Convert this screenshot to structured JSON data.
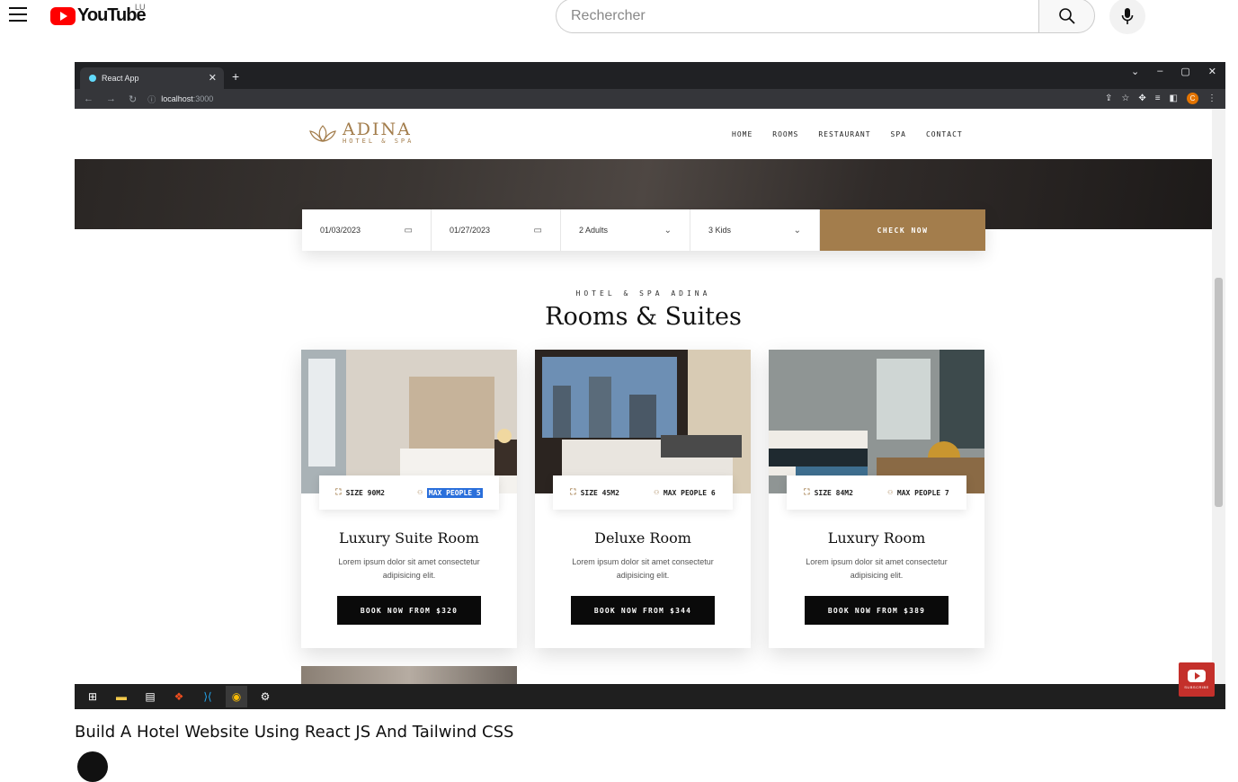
{
  "youtube": {
    "logo_text": "YouTube",
    "country": "LU",
    "search_placeholder": "Rechercher"
  },
  "browser": {
    "tab_title": "React App",
    "url_host": "localhost",
    "url_port": ":3000"
  },
  "site": {
    "brand_name": "ADINA",
    "brand_sub": "HOTEL & SPA",
    "nav": [
      "HOME",
      "ROOMS",
      "RESTAURANT",
      "SPA",
      "CONTACT"
    ],
    "booking": {
      "check_in": "01/03/2023",
      "check_out": "01/27/2023",
      "adults": "2 Adults",
      "kids": "3 Kids",
      "button": "CHECK NOW"
    },
    "rooms_eyebrow": "HOTEL & SPA ADINA",
    "rooms_title": "Rooms & Suites",
    "rooms": [
      {
        "name": "Luxury Suite Room",
        "size": "SIZE 90M2",
        "max": "MAX PEOPLE 5",
        "desc": "Lorem ipsum dolor sit amet consectetur adipisicing elit.",
        "button": "BOOK NOW FROM $320"
      },
      {
        "name": "Deluxe Room",
        "size": "SIZE 45M2",
        "max": "MAX PEOPLE 6",
        "desc": "Lorem ipsum dolor sit amet consectetur adipisicing elit.",
        "button": "BOOK NOW FROM $344"
      },
      {
        "name": "Luxury Room",
        "size": "SIZE 84M2",
        "max": "MAX PEOPLE 7",
        "desc": "Lorem ipsum dolor sit amet consectetur adipisicing elit.",
        "button": "BOOK NOW FROM $389"
      }
    ]
  },
  "video": {
    "subscribe_label": "SUBSCRIBE",
    "title": "Build A Hotel Website Using React JS And Tailwind CSS"
  },
  "colors": {
    "accent_gold": "#a37d4c",
    "youtube_red": "#ff0000",
    "selection_blue": "#2a6fdb"
  }
}
